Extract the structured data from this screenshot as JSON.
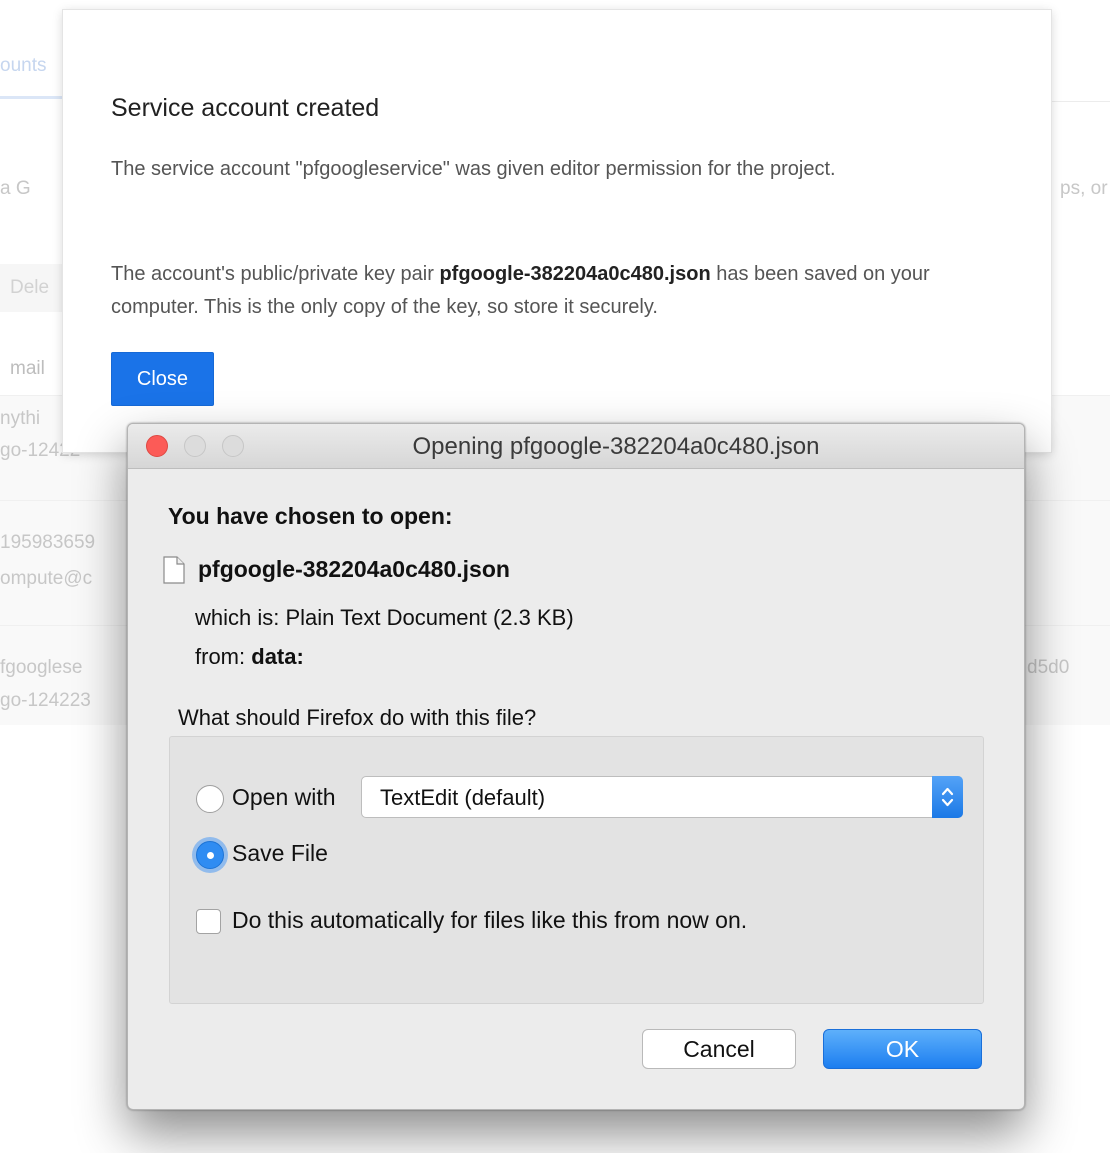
{
  "background": {
    "tab_label": "ounts",
    "intro_left": "a G",
    "intro_right": "ps, or",
    "delete_label": "Dele",
    "email_header": "mail",
    "rows": [
      {
        "line1": "nythi",
        "line2": "go-12422"
      },
      {
        "line1": "195983659",
        "line2": "ompute@c"
      },
      {
        "line1": "fgooglese",
        "line2": "go-124223",
        "right": "d5d0"
      }
    ]
  },
  "service_modal": {
    "title": "Service account created",
    "paragraph1": "The service account \"pfgoogleservice\" was given editor permission for the project.",
    "paragraph2_before": "The account's public/private key pair ",
    "paragraph2_filename": "pfgoogle-382204a0c480.json",
    "paragraph2_after": " has been saved on your computer. This is the only copy of the key, so store it securely.",
    "close_label": "Close"
  },
  "firefox_dialog": {
    "window_title": "Opening pfgoogle-382204a0c480.json",
    "heading": "You have chosen to open:",
    "file_name": "pfgoogle-382204a0c480.json",
    "which_is_label": "which is:",
    "which_is_value": "Plain Text Document (2.3 KB)",
    "from_label": "from:",
    "from_value": "data:",
    "question": "What should Firefox do with this file?",
    "open_with_label": "Open with",
    "open_with_app": "TextEdit (default)",
    "save_file_label": "Save File",
    "selected_option": "Save File",
    "auto_label": "Do this automatically for files like this from now on.",
    "auto_checked": false,
    "cancel_label": "Cancel",
    "ok_label": "OK"
  },
  "colors": {
    "google_blue": "#1a73e8",
    "mac_close_red": "#fc5b57",
    "mac_accent_blue": "#2f8cf2"
  }
}
